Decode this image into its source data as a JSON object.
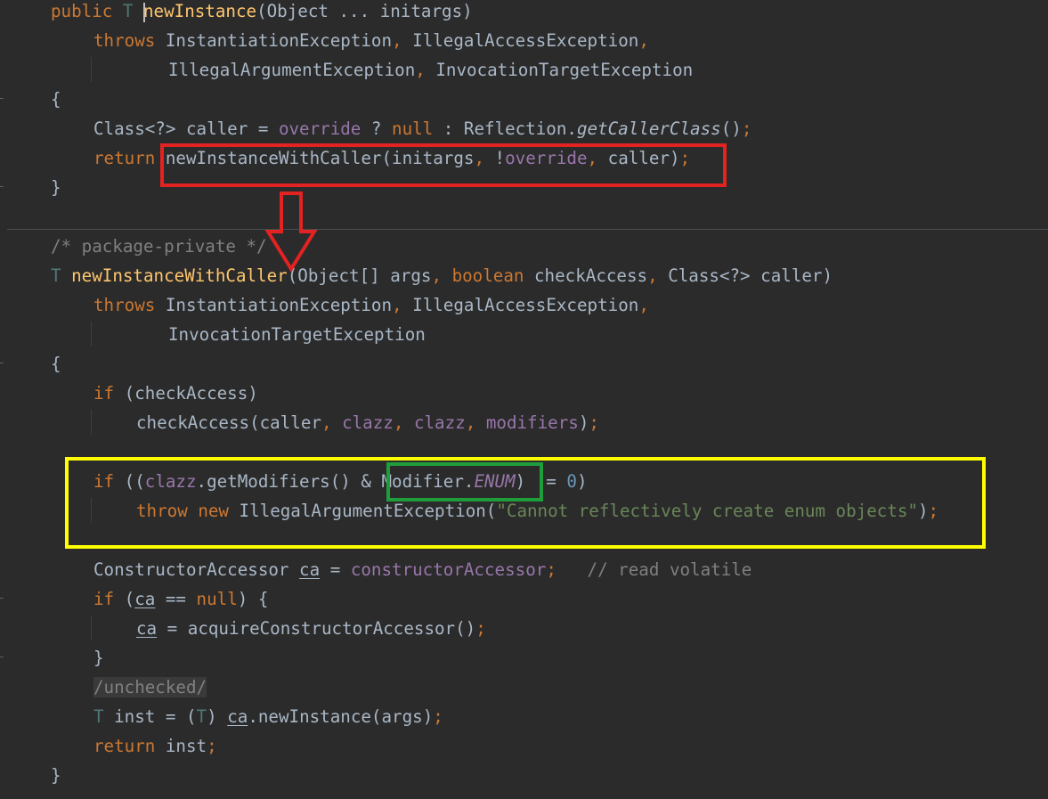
{
  "code": {
    "l1": {
      "kw": "public",
      "type": "T",
      "name": "newInstance",
      "params": "(Object ... initargs)"
    },
    "l2": {
      "kw": "throws",
      "e1": "InstantiationException",
      "c1": ",",
      "e2": "IllegalAccessException",
      "c2": ","
    },
    "l3": {
      "e1": "IllegalArgumentException",
      "c1": ",",
      "e2": "InvocationTargetException"
    },
    "l4": {
      "brace": "{"
    },
    "l5": {
      "a": "Class<?> caller = ",
      "f1": "override",
      "b": " ? ",
      "kw": "null",
      "c": " : Reflection.",
      "m": "getCallerClass",
      "d": "()",
      "semi": ";"
    },
    "l6": {
      "kw": "return",
      "a": "newInstanceWithCaller(initargs",
      "c1": ",",
      "b": " !",
      "f": "override",
      "c2": ",",
      "d": " caller)",
      "semi": ";"
    },
    "l7": {
      "brace": "}"
    },
    "l8": {
      "comment": "/* package-private */"
    },
    "l9": {
      "type": "T",
      "name": "newInstanceWithCaller",
      "a": "(Object[] args",
      "c1": ",",
      "kw": "boolean",
      "b": " checkAccess",
      "c2": ",",
      "c": " Class<?> caller)"
    },
    "l10": {
      "kw": "throws",
      "e1": "InstantiationException",
      "c1": ",",
      "e2": "IllegalAccessException",
      "c2": ","
    },
    "l11": {
      "e1": "InvocationTargetException"
    },
    "l12": {
      "brace": "{"
    },
    "l13": {
      "kw": "if",
      "a": " (checkAccess)"
    },
    "l14": {
      "a": "checkAccess(caller",
      "c1": ",",
      "f1": "clazz",
      "c2": ",",
      "f2": "clazz",
      "c3": ",",
      "f3": "modifiers",
      "b": ")",
      "semi": ";"
    },
    "l15": {
      "kw": "if",
      "a": " ((",
      "f": "clazz",
      "b": ".getModifiers() & Modifier.",
      "st": "ENUM",
      "c": ") != ",
      "num": "0",
      "d": ")"
    },
    "l16": {
      "kw1": "throw",
      "kw2": "new",
      "a": "IllegalArgumentException(",
      "str": "\"Cannot reflectively create enum objects\"",
      "b": ")",
      "semi": ";"
    },
    "l17": {
      "a": "ConstructorAccessor ",
      "var": "ca",
      "b": " = ",
      "f": "constructorAccessor",
      "semi": ";",
      "comment": "// read volatile"
    },
    "l18": {
      "kw": "if",
      "a": " (",
      "var": "ca",
      "b": " == ",
      "kw2": "null",
      "c": ") {"
    },
    "l19": {
      "var": "ca",
      "a": " = acquireConstructorAccessor()",
      "semi": ";"
    },
    "l20": {
      "brace": "}"
    },
    "l21": {
      "annot": "/unchecked/"
    },
    "l22": {
      "type": "T",
      "a": " inst = (",
      "type2": "T",
      "b": ") ",
      "var": "ca",
      "c": ".newInstance(args)",
      "semi": ";"
    },
    "l23": {
      "kw": "return",
      "a": " inst",
      "semi": ";"
    },
    "l24": {
      "brace": "}"
    }
  },
  "annotations": {
    "red_box_color": "#e32222",
    "yellow_box_color": "#ffff00",
    "green_box_color": "#1f9d3a",
    "arrow_color": "#e32222"
  },
  "theme": {
    "background": "#2b2b2b",
    "keyword": "#cc7832",
    "function": "#ffc66d",
    "string": "#6a8759",
    "field": "#9876aa"
  }
}
